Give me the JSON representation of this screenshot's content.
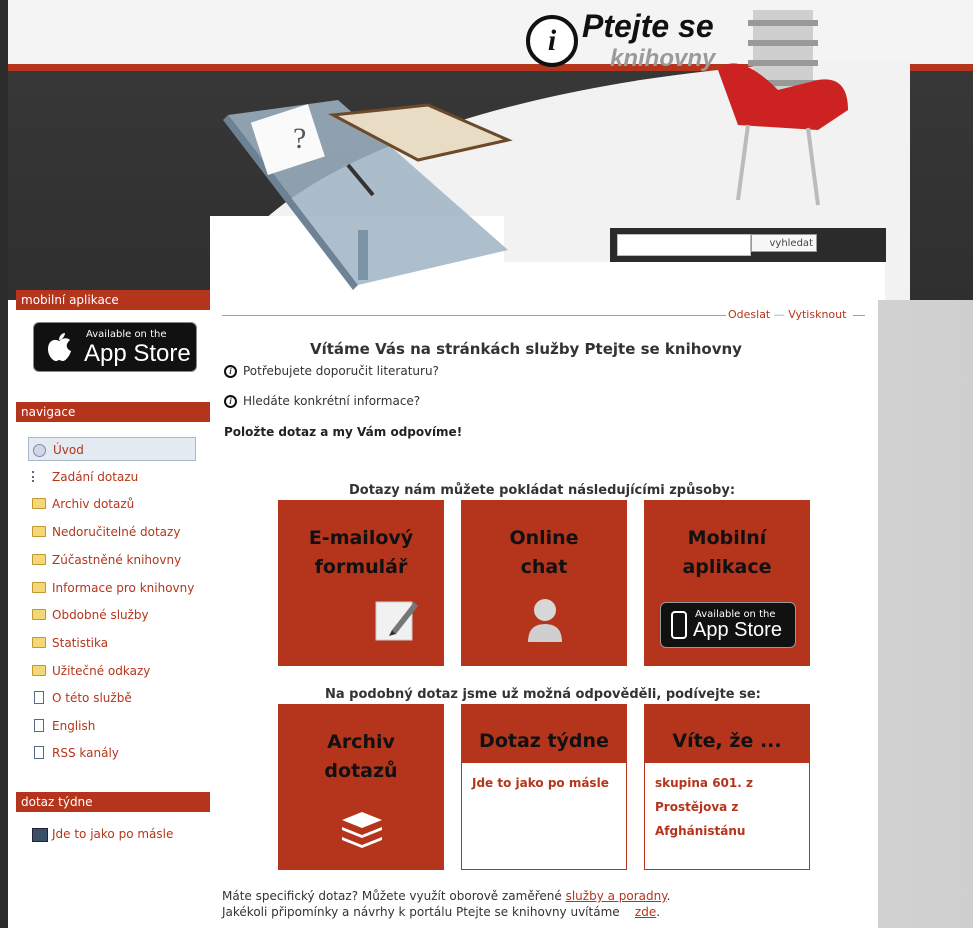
{
  "header": {
    "logo_line1": "Ptejte se",
    "logo_line2": "knihovny",
    "search": {
      "button": "vyhledat",
      "value": ""
    }
  },
  "sidebar": {
    "mobile_heading": "mobilní aplikace",
    "appstore": {
      "small": "Available on the",
      "big": "App Store"
    },
    "nav_heading": "navigace",
    "nav_items": [
      "Úvod",
      "Zadání dotazu",
      "Archiv dotazů",
      "Nedoručitelné dotazy",
      "Zúčastněné knihovny",
      "Informace pro knihovny",
      "Obdobné služby",
      "Statistika",
      "Užitečné odkazy",
      "O této službě",
      "English",
      "RSS kanály"
    ],
    "week_heading": "dotaz týdne",
    "week_item": "Jde to jako po másle"
  },
  "toolbar": {
    "send": "Odeslat",
    "print": "Vytisknout"
  },
  "main": {
    "title": "Vítáme Vás na stránkách služby Ptejte se knihovny",
    "q1": "Potřebujete doporučit literaturu?",
    "q2": "Hledáte konkrétní informace?",
    "bold": "Položte dotaz a my Vám odpovíme!",
    "ways_heading": "Dotazy nám můžete pokládat následujícími způsoby:",
    "tile_email": [
      "E-mailový",
      "formulář"
    ],
    "tile_chat": [
      "Online",
      "chat"
    ],
    "tile_mobile": [
      "Mobilní",
      "aplikace"
    ],
    "tile_appstore": {
      "small": "Available on the",
      "big": "App Store"
    },
    "answered_heading": "Na podobný dotaz jsme už možná odpověděli, podívejte se:",
    "tile_archive": [
      "Archiv",
      "dotazů"
    ],
    "week_tile": {
      "title": "Dotaz týdne",
      "text": "Jde to jako po másle"
    },
    "know_tile": {
      "title": "Víte, že ...",
      "text": "skupina 601. z Prostějova z Afghánistánu"
    },
    "footer1_pre": "Máte specifický dotaz? Můžete využít oborově zaměřené ",
    "footer1_link": "služby a poradny",
    "footer1_post": ".",
    "footer2_pre": "Jakékoli připomínky a návrhy k portálu Ptejte se knihovny uvítáme ",
    "footer2_link": "zde",
    "footer2_post": "."
  },
  "colors": {
    "accent": "#b4351c",
    "dark": "#2f2f2f"
  }
}
